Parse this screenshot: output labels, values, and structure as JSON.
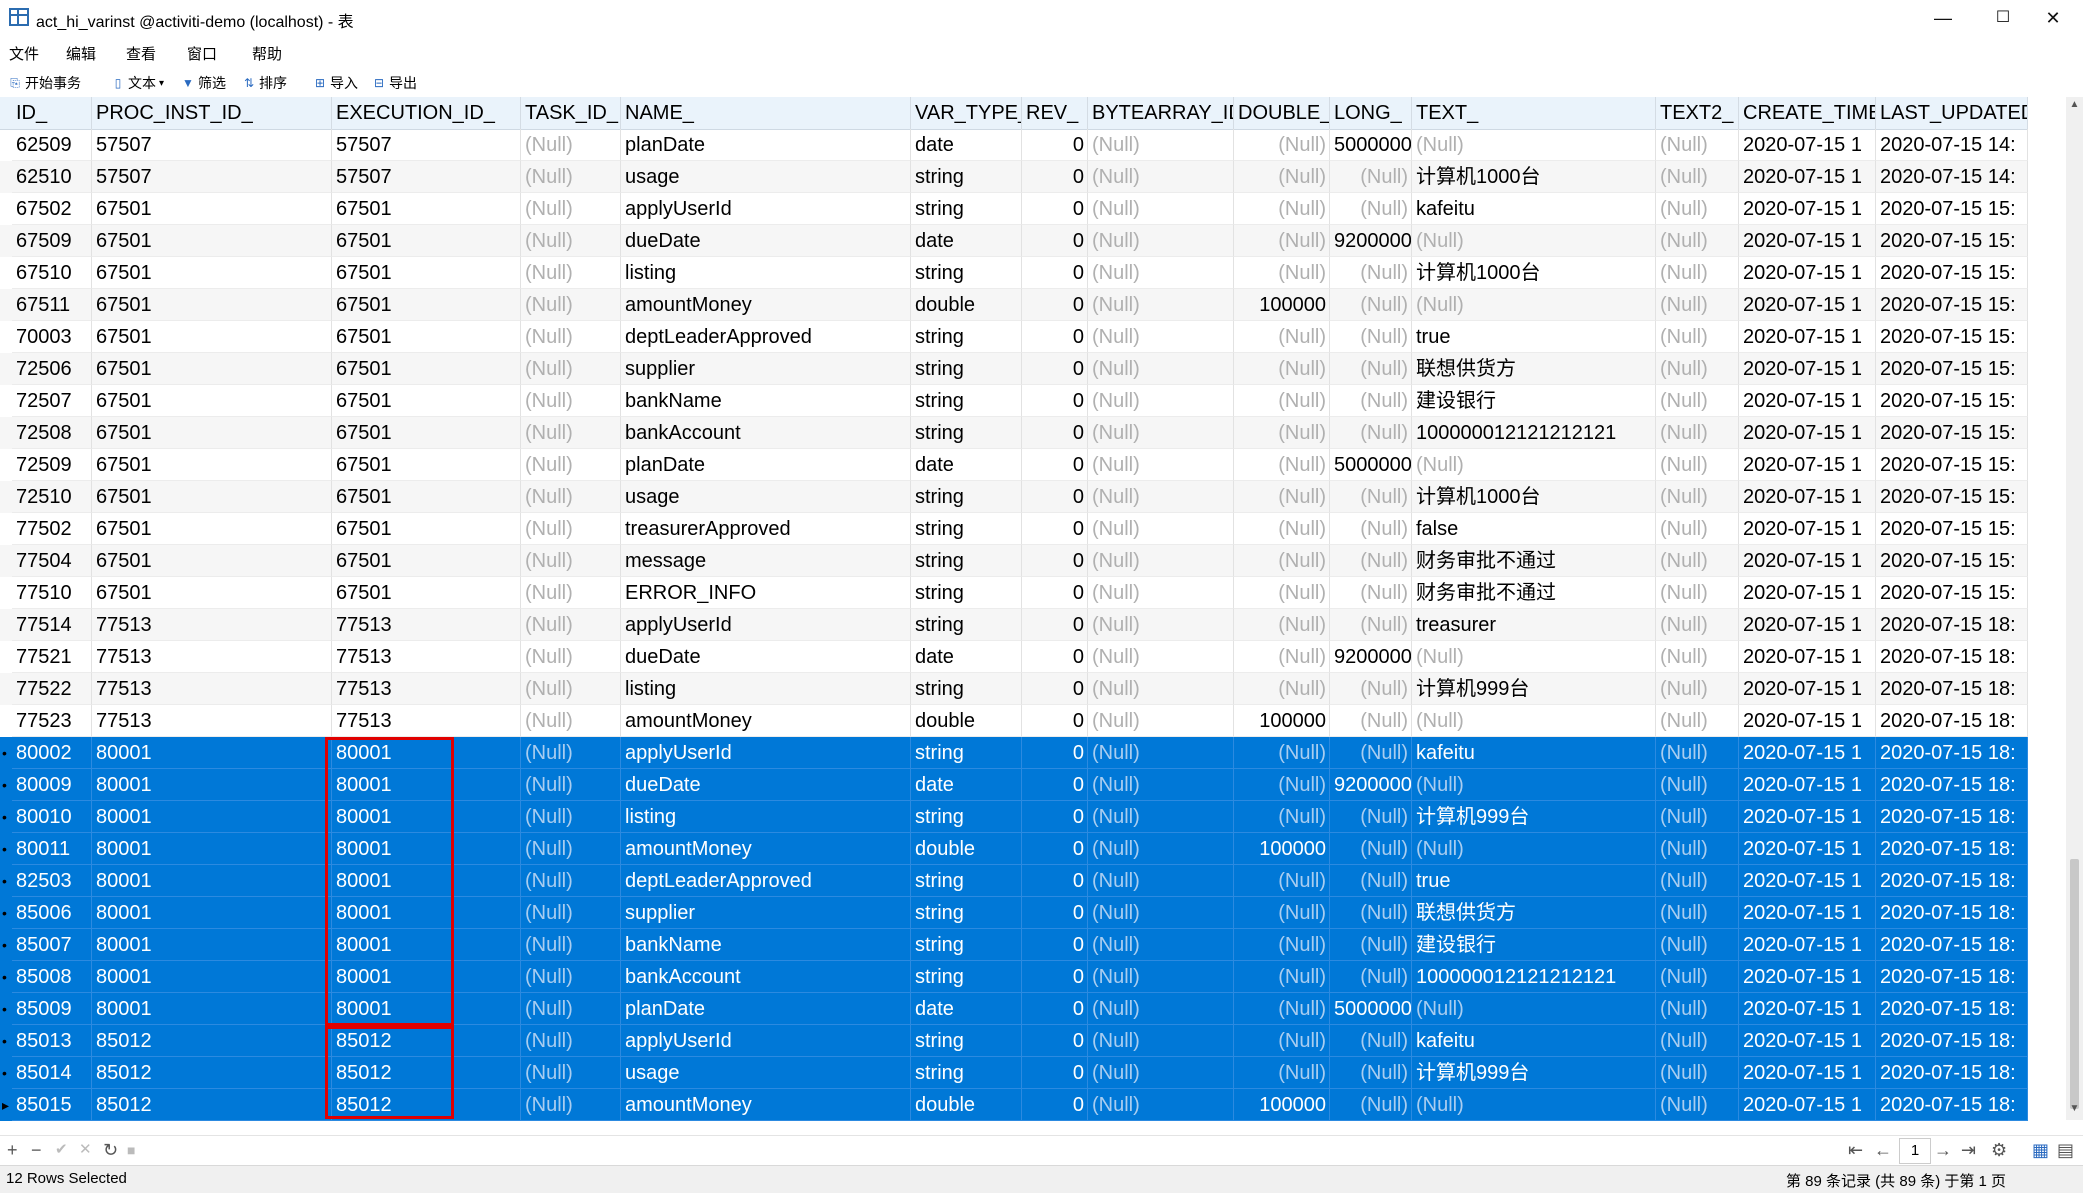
{
  "window": {
    "title": "act_hi_varinst @activiti-demo (localhost) - 表",
    "minimize": "—",
    "maximize": "☐",
    "close": "✕"
  },
  "menu": [
    "文件",
    "编辑",
    "查看",
    "窗口",
    "帮助"
  ],
  "toolbar": {
    "begin_transaction": "开始事务",
    "text": "文本",
    "filter": "筛选",
    "sort": "排序",
    "import": "导入",
    "export": "导出"
  },
  "columns": [
    "ID_",
    "PROC_INST_ID_",
    "EXECUTION_ID_",
    "TASK_ID_",
    "NAME_",
    "VAR_TYPE_",
    "REV_",
    "BYTEARRAY_ID_",
    "DOUBLE_",
    "LONG_",
    "TEXT_",
    "TEXT2_",
    "CREATE_TIME",
    "LAST_UPDATED_"
  ],
  "rows": [
    {
      "id": "62509",
      "proc": "57507",
      "exec": "57507",
      "task": "(Null)",
      "name": "planDate",
      "type": "date",
      "rev": "0",
      "byte": "(Null)",
      "dbl": "(Null)",
      "lng": "5000000",
      "text": "(Null)",
      "text2": "(Null)",
      "ct": "2020-07-15 1",
      "lu": "2020-07-15 14:",
      "sel": false
    },
    {
      "id": "62510",
      "proc": "57507",
      "exec": "57507",
      "task": "(Null)",
      "name": "usage",
      "type": "string",
      "rev": "0",
      "byte": "(Null)",
      "dbl": "(Null)",
      "lng": "(Null)",
      "text": "计算机1000台",
      "text2": "(Null)",
      "ct": "2020-07-15 1",
      "lu": "2020-07-15 14:",
      "sel": false
    },
    {
      "id": "67502",
      "proc": "67501",
      "exec": "67501",
      "task": "(Null)",
      "name": "applyUserId",
      "type": "string",
      "rev": "0",
      "byte": "(Null)",
      "dbl": "(Null)",
      "lng": "(Null)",
      "text": "kafeitu",
      "text2": "(Null)",
      "ct": "2020-07-15 1",
      "lu": "2020-07-15 15:",
      "sel": false
    },
    {
      "id": "67509",
      "proc": "67501",
      "exec": "67501",
      "task": "(Null)",
      "name": "dueDate",
      "type": "date",
      "rev": "0",
      "byte": "(Null)",
      "dbl": "(Null)",
      "lng": "9200000",
      "text": "(Null)",
      "text2": "(Null)",
      "ct": "2020-07-15 1",
      "lu": "2020-07-15 15:",
      "sel": false
    },
    {
      "id": "67510",
      "proc": "67501",
      "exec": "67501",
      "task": "(Null)",
      "name": "listing",
      "type": "string",
      "rev": "0",
      "byte": "(Null)",
      "dbl": "(Null)",
      "lng": "(Null)",
      "text": "计算机1000台",
      "text2": "(Null)",
      "ct": "2020-07-15 1",
      "lu": "2020-07-15 15:",
      "sel": false
    },
    {
      "id": "67511",
      "proc": "67501",
      "exec": "67501",
      "task": "(Null)",
      "name": "amountMoney",
      "type": "double",
      "rev": "0",
      "byte": "(Null)",
      "dbl": "100000",
      "lng": "(Null)",
      "text": "(Null)",
      "text2": "(Null)",
      "ct": "2020-07-15 1",
      "lu": "2020-07-15 15:",
      "sel": false
    },
    {
      "id": "70003",
      "proc": "67501",
      "exec": "67501",
      "task": "(Null)",
      "name": "deptLeaderApproved",
      "type": "string",
      "rev": "0",
      "byte": "(Null)",
      "dbl": "(Null)",
      "lng": "(Null)",
      "text": "true",
      "text2": "(Null)",
      "ct": "2020-07-15 1",
      "lu": "2020-07-15 15:",
      "sel": false
    },
    {
      "id": "72506",
      "proc": "67501",
      "exec": "67501",
      "task": "(Null)",
      "name": "supplier",
      "type": "string",
      "rev": "0",
      "byte": "(Null)",
      "dbl": "(Null)",
      "lng": "(Null)",
      "text": "联想供货方",
      "text2": "(Null)",
      "ct": "2020-07-15 1",
      "lu": "2020-07-15 15:",
      "sel": false
    },
    {
      "id": "72507",
      "proc": "67501",
      "exec": "67501",
      "task": "(Null)",
      "name": "bankName",
      "type": "string",
      "rev": "0",
      "byte": "(Null)",
      "dbl": "(Null)",
      "lng": "(Null)",
      "text": "建设银行",
      "text2": "(Null)",
      "ct": "2020-07-15 1",
      "lu": "2020-07-15 15:",
      "sel": false
    },
    {
      "id": "72508",
      "proc": "67501",
      "exec": "67501",
      "task": "(Null)",
      "name": "bankAccount",
      "type": "string",
      "rev": "0",
      "byte": "(Null)",
      "dbl": "(Null)",
      "lng": "(Null)",
      "text": "100000012121212121",
      "text2": "(Null)",
      "ct": "2020-07-15 1",
      "lu": "2020-07-15 15:",
      "sel": false
    },
    {
      "id": "72509",
      "proc": "67501",
      "exec": "67501",
      "task": "(Null)",
      "name": "planDate",
      "type": "date",
      "rev": "0",
      "byte": "(Null)",
      "dbl": "(Null)",
      "lng": "5000000",
      "text": "(Null)",
      "text2": "(Null)",
      "ct": "2020-07-15 1",
      "lu": "2020-07-15 15:",
      "sel": false
    },
    {
      "id": "72510",
      "proc": "67501",
      "exec": "67501",
      "task": "(Null)",
      "name": "usage",
      "type": "string",
      "rev": "0",
      "byte": "(Null)",
      "dbl": "(Null)",
      "lng": "(Null)",
      "text": "计算机1000台",
      "text2": "(Null)",
      "ct": "2020-07-15 1",
      "lu": "2020-07-15 15:",
      "sel": false
    },
    {
      "id": "77502",
      "proc": "67501",
      "exec": "67501",
      "task": "(Null)",
      "name": "treasurerApproved",
      "type": "string",
      "rev": "0",
      "byte": "(Null)",
      "dbl": "(Null)",
      "lng": "(Null)",
      "text": "false",
      "text2": "(Null)",
      "ct": "2020-07-15 1",
      "lu": "2020-07-15 15:",
      "sel": false
    },
    {
      "id": "77504",
      "proc": "67501",
      "exec": "67501",
      "task": "(Null)",
      "name": "message",
      "type": "string",
      "rev": "0",
      "byte": "(Null)",
      "dbl": "(Null)",
      "lng": "(Null)",
      "text": "财务审批不通过",
      "text2": "(Null)",
      "ct": "2020-07-15 1",
      "lu": "2020-07-15 15:",
      "sel": false
    },
    {
      "id": "77510",
      "proc": "67501",
      "exec": "67501",
      "task": "(Null)",
      "name": "ERROR_INFO",
      "type": "string",
      "rev": "0",
      "byte": "(Null)",
      "dbl": "(Null)",
      "lng": "(Null)",
      "text": "财务审批不通过",
      "text2": "(Null)",
      "ct": "2020-07-15 1",
      "lu": "2020-07-15 15:",
      "sel": false
    },
    {
      "id": "77514",
      "proc": "77513",
      "exec": "77513",
      "task": "(Null)",
      "name": "applyUserId",
      "type": "string",
      "rev": "0",
      "byte": "(Null)",
      "dbl": "(Null)",
      "lng": "(Null)",
      "text": "treasurer",
      "text2": "(Null)",
      "ct": "2020-07-15 1",
      "lu": "2020-07-15 18:",
      "sel": false
    },
    {
      "id": "77521",
      "proc": "77513",
      "exec": "77513",
      "task": "(Null)",
      "name": "dueDate",
      "type": "date",
      "rev": "0",
      "byte": "(Null)",
      "dbl": "(Null)",
      "lng": "9200000",
      "text": "(Null)",
      "text2": "(Null)",
      "ct": "2020-07-15 1",
      "lu": "2020-07-15 18:",
      "sel": false
    },
    {
      "id": "77522",
      "proc": "77513",
      "exec": "77513",
      "task": "(Null)",
      "name": "listing",
      "type": "string",
      "rev": "0",
      "byte": "(Null)",
      "dbl": "(Null)",
      "lng": "(Null)",
      "text": "计算机999台",
      "text2": "(Null)",
      "ct": "2020-07-15 1",
      "lu": "2020-07-15 18:",
      "sel": false
    },
    {
      "id": "77523",
      "proc": "77513",
      "exec": "77513",
      "task": "(Null)",
      "name": "amountMoney",
      "type": "double",
      "rev": "0",
      "byte": "(Null)",
      "dbl": "100000",
      "lng": "(Null)",
      "text": "(Null)",
      "text2": "(Null)",
      "ct": "2020-07-15 1",
      "lu": "2020-07-15 18:",
      "sel": false
    },
    {
      "id": "80002",
      "proc": "80001",
      "exec": "80001",
      "task": "(Null)",
      "name": "applyUserId",
      "type": "string",
      "rev": "0",
      "byte": "(Null)",
      "dbl": "(Null)",
      "lng": "(Null)",
      "text": "kafeitu",
      "text2": "(Null)",
      "ct": "2020-07-15 1",
      "lu": "2020-07-15 18:",
      "sel": true
    },
    {
      "id": "80009",
      "proc": "80001",
      "exec": "80001",
      "task": "(Null)",
      "name": "dueDate",
      "type": "date",
      "rev": "0",
      "byte": "(Null)",
      "dbl": "(Null)",
      "lng": "9200000",
      "text": "(Null)",
      "text2": "(Null)",
      "ct": "2020-07-15 1",
      "lu": "2020-07-15 18:",
      "sel": true
    },
    {
      "id": "80010",
      "proc": "80001",
      "exec": "80001",
      "task": "(Null)",
      "name": "listing",
      "type": "string",
      "rev": "0",
      "byte": "(Null)",
      "dbl": "(Null)",
      "lng": "(Null)",
      "text": "计算机999台",
      "text2": "(Null)",
      "ct": "2020-07-15 1",
      "lu": "2020-07-15 18:",
      "sel": true
    },
    {
      "id": "80011",
      "proc": "80001",
      "exec": "80001",
      "task": "(Null)",
      "name": "amountMoney",
      "type": "double",
      "rev": "0",
      "byte": "(Null)",
      "dbl": "100000",
      "lng": "(Null)",
      "text": "(Null)",
      "text2": "(Null)",
      "ct": "2020-07-15 1",
      "lu": "2020-07-15 18:",
      "sel": true
    },
    {
      "id": "82503",
      "proc": "80001",
      "exec": "80001",
      "task": "(Null)",
      "name": "deptLeaderApproved",
      "type": "string",
      "rev": "0",
      "byte": "(Null)",
      "dbl": "(Null)",
      "lng": "(Null)",
      "text": "true",
      "text2": "(Null)",
      "ct": "2020-07-15 1",
      "lu": "2020-07-15 18:",
      "sel": true
    },
    {
      "id": "85006",
      "proc": "80001",
      "exec": "80001",
      "task": "(Null)",
      "name": "supplier",
      "type": "string",
      "rev": "0",
      "byte": "(Null)",
      "dbl": "(Null)",
      "lng": "(Null)",
      "text": "联想供货方",
      "text2": "(Null)",
      "ct": "2020-07-15 1",
      "lu": "2020-07-15 18:",
      "sel": true
    },
    {
      "id": "85007",
      "proc": "80001",
      "exec": "80001",
      "task": "(Null)",
      "name": "bankName",
      "type": "string",
      "rev": "0",
      "byte": "(Null)",
      "dbl": "(Null)",
      "lng": "(Null)",
      "text": "建设银行",
      "text2": "(Null)",
      "ct": "2020-07-15 1",
      "lu": "2020-07-15 18:",
      "sel": true
    },
    {
      "id": "85008",
      "proc": "80001",
      "exec": "80001",
      "task": "(Null)",
      "name": "bankAccount",
      "type": "string",
      "rev": "0",
      "byte": "(Null)",
      "dbl": "(Null)",
      "lng": "(Null)",
      "text": "100000012121212121",
      "text2": "(Null)",
      "ct": "2020-07-15 1",
      "lu": "2020-07-15 18:",
      "sel": true
    },
    {
      "id": "85009",
      "proc": "80001",
      "exec": "80001",
      "task": "(Null)",
      "name": "planDate",
      "type": "date",
      "rev": "0",
      "byte": "(Null)",
      "dbl": "(Null)",
      "lng": "5000000",
      "text": "(Null)",
      "text2": "(Null)",
      "ct": "2020-07-15 1",
      "lu": "2020-07-15 18:",
      "sel": true
    },
    {
      "id": "85013",
      "proc": "85012",
      "exec": "85012",
      "task": "(Null)",
      "name": "applyUserId",
      "type": "string",
      "rev": "0",
      "byte": "(Null)",
      "dbl": "(Null)",
      "lng": "(Null)",
      "text": "kafeitu",
      "text2": "(Null)",
      "ct": "2020-07-15 1",
      "lu": "2020-07-15 18:",
      "sel": true
    },
    {
      "id": "85014",
      "proc": "85012",
      "exec": "85012",
      "task": "(Null)",
      "name": "usage",
      "type": "string",
      "rev": "0",
      "byte": "(Null)",
      "dbl": "(Null)",
      "lng": "(Null)",
      "text": "计算机999台",
      "text2": "(Null)",
      "ct": "2020-07-15 1",
      "lu": "2020-07-15 18:",
      "sel": true
    },
    {
      "id": "85015",
      "proc": "85012",
      "exec": "85012",
      "task": "(Null)",
      "name": "amountMoney",
      "type": "double",
      "rev": "0",
      "byte": "(Null)",
      "dbl": "100000",
      "lng": "(Null)",
      "text": "(Null)",
      "text2": "(Null)",
      "ct": "2020-07-15 1",
      "lu": "2020-07-15 18:",
      "sel": true
    }
  ],
  "nav": {
    "add": "+",
    "remove": "−",
    "apply": "✔",
    "discard": "✕",
    "refresh": "↻",
    "stop": "■",
    "first": "⇤",
    "prev": "←",
    "page": "1",
    "next": "→",
    "last": "⇥",
    "settings": "⚙",
    "grid_view": "▦",
    "form_view": "▤"
  },
  "status": {
    "selected": "12 Rows Selected",
    "records": "第 89 条记录 (共 89 条) 于第 1 页"
  },
  "colors": {
    "selection": "#0078d7",
    "highlight_box": "#e00000",
    "header": "#eaf3fb"
  }
}
